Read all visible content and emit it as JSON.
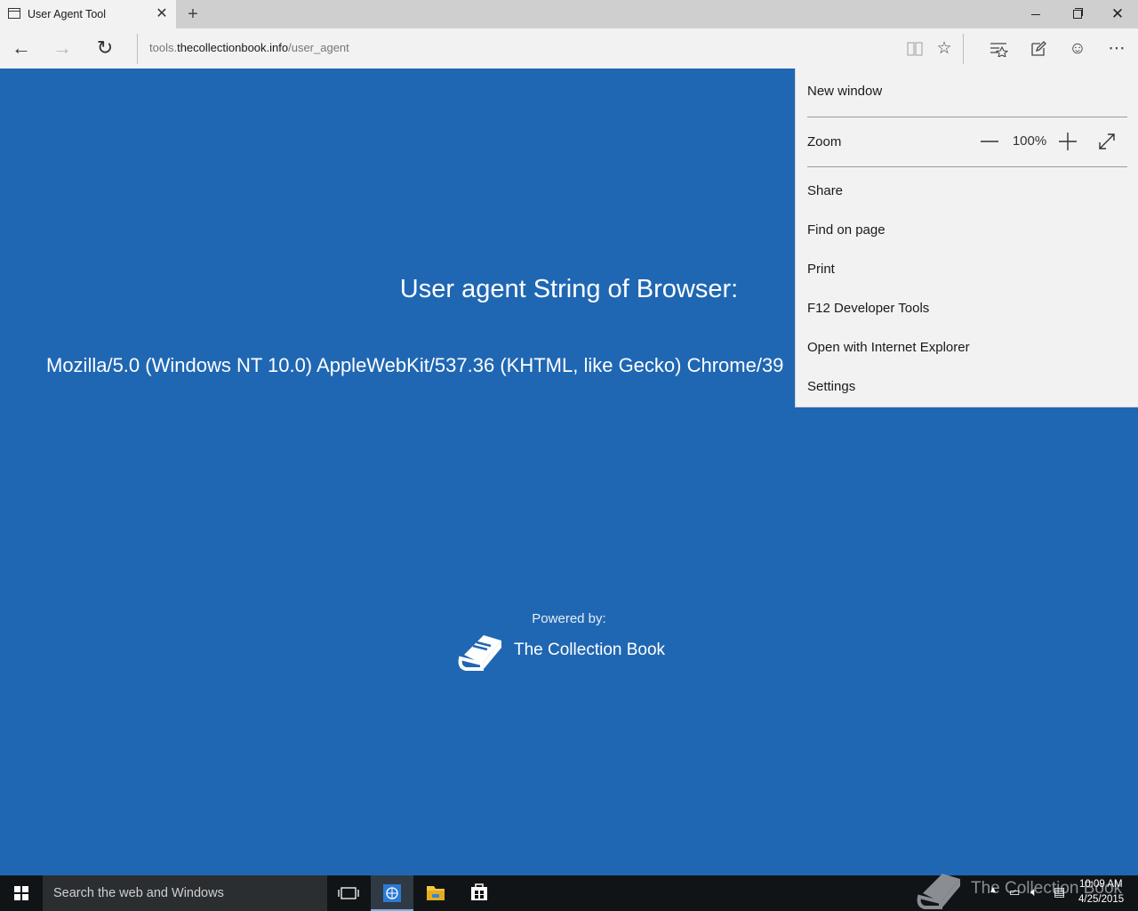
{
  "browser": {
    "tab_title": "User Agent Tool",
    "address_prefix": "tools.",
    "address_host": "thecollectionbook.info",
    "address_path": "/user_agent"
  },
  "page": {
    "heading": "User agent String of Browser:",
    "ua_string": "Mozilla/5.0 (Windows NT 10.0) AppleWebKit/537.36 (KHTML, like Gecko) Chrome/39",
    "powered_by": "Powered by:",
    "brand_name": "The Collection Book"
  },
  "menu": {
    "new_window": "New window",
    "zoom_label": "Zoom",
    "zoom_value": "100%",
    "items": [
      "Share",
      "Find on page",
      "Print",
      "F12 Developer Tools",
      "Open with Internet Explorer",
      "Settings"
    ]
  },
  "taskbar": {
    "search_placeholder": "Search the web and Windows",
    "watermark": "The Collection Book",
    "time": "10:09 AM",
    "date": "4/25/2015"
  },
  "colors": {
    "page_background": "#1f67b3",
    "menu_background": "#f2f2f2",
    "taskbar": "#111417"
  },
  "icons": [
    "tab-page-icon",
    "close-icon",
    "plus-icon",
    "minimize-icon",
    "restore-icon",
    "back-arrow-icon",
    "forward-arrow-icon",
    "refresh-icon",
    "reading-view-icon",
    "star-icon",
    "hub-icon",
    "web-note-icon",
    "smiley-icon",
    "more-icon",
    "book-icon",
    "windows-logo-icon",
    "task-view-icon",
    "edge-icon",
    "folder-icon",
    "store-icon"
  ]
}
